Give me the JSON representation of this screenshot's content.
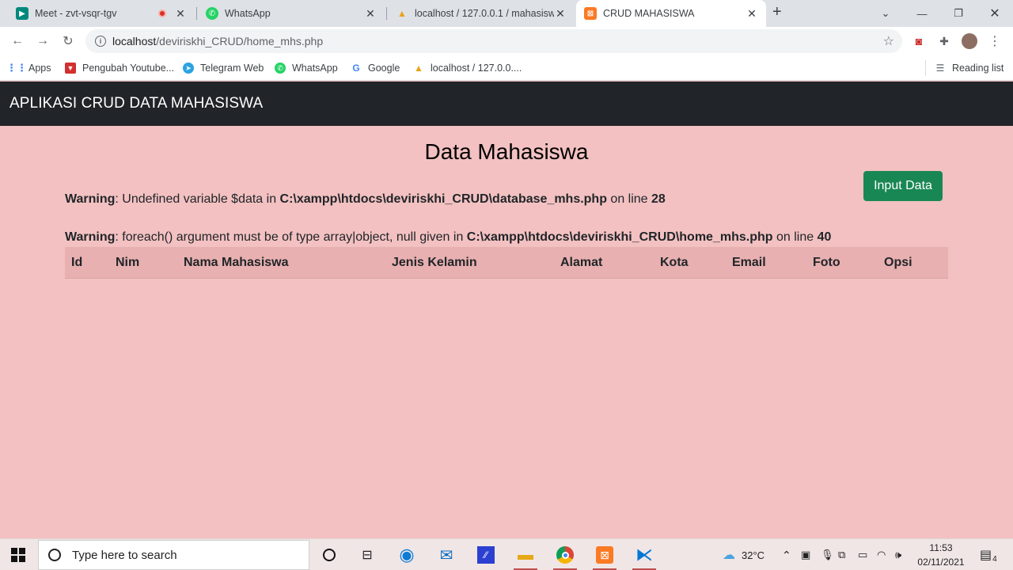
{
  "browser": {
    "tabs": [
      {
        "title": "Meet - zvt-vsqr-tgv",
        "favicon": "google-meet-icon",
        "recording": true
      },
      {
        "title": "WhatsApp",
        "favicon": "whatsapp-icon"
      },
      {
        "title": "localhost / 127.0.0.1 / mahasiswa",
        "favicon": "phpmyadmin-icon"
      },
      {
        "title": "CRUD MAHASISWA",
        "favicon": "xampp-icon",
        "active": true
      }
    ],
    "url_host": "localhost",
    "url_path": "/deviriskhi_CRUD/home_mhs.php",
    "bookmarks": [
      {
        "label": "Apps",
        "icon": "apps-grid-icon"
      },
      {
        "label": "Pengubah Youtube...",
        "icon": "youtube-converter-icon"
      },
      {
        "label": "Telegram Web",
        "icon": "telegram-icon"
      },
      {
        "label": "WhatsApp",
        "icon": "whatsapp-icon"
      },
      {
        "label": "Google",
        "icon": "google-icon"
      },
      {
        "label": "localhost / 127.0.0....",
        "icon": "phpmyadmin-icon"
      }
    ],
    "reading_list": "Reading list"
  },
  "app": {
    "brand": "APLIKASI CRUD DATA MAHASISWA",
    "heading": "Data Mahasiswa",
    "input_button": "Input Data",
    "warnings": [
      {
        "label": "Warning",
        "message": ": Undefined variable $data in ",
        "path": "C:\\xampp\\htdocs\\deviriskhi_CRUD\\database_mhs.php",
        "online": " on line ",
        "line": "28"
      },
      {
        "label": "Warning",
        "message": ": foreach() argument must be of type array|object, null given in ",
        "path": "C:\\xampp\\htdocs\\deviriskhi_CRUD\\home_mhs.php",
        "online": " on line ",
        "line": "40"
      }
    ],
    "table_headers": [
      "Id",
      "Nim",
      "Nama Mahasiswa",
      "Jenis Kelamin",
      "Alamat",
      "Kota",
      "Email",
      "Foto",
      "Opsi"
    ]
  },
  "taskbar": {
    "search_placeholder": "Type here to search",
    "temperature": "32°C",
    "time": "11:53",
    "date": "02/11/2021",
    "notifications": "4"
  },
  "colors": {
    "page_bg": "#f3c1c1",
    "navbar_bg": "#212529",
    "button_green": "#198754",
    "table_header_bg": "#e8b0b0"
  }
}
